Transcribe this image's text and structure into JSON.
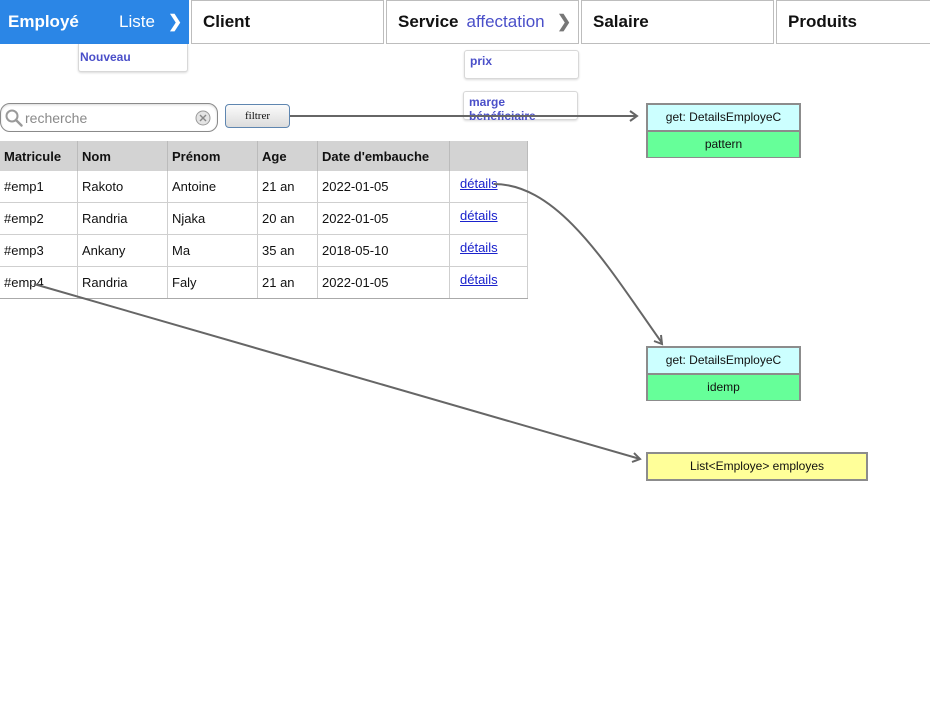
{
  "nav": {
    "tabs": [
      {
        "label": "Employé",
        "sub": "Liste",
        "chevron": "❯"
      },
      {
        "label": "Client"
      },
      {
        "label": "Service",
        "sub": "affectation",
        "chevron": "❯"
      },
      {
        "label": "Salaire"
      },
      {
        "label": "Produits"
      }
    ],
    "employe_menu": [
      "Nouveau"
    ],
    "service_menu": [
      "prix",
      "marge bénéficiaire"
    ]
  },
  "search": {
    "placeholder": "recherche",
    "filter_label": "filtrer"
  },
  "table": {
    "headers": [
      "Matricule",
      "Nom",
      "Prénom",
      "Age",
      "Date d'embauche",
      ""
    ],
    "rows": [
      {
        "matricule": "#emp1",
        "nom": "Rakoto",
        "prenom": "Antoine",
        "age": "21 an",
        "date": "2022-01-05",
        "link": "détails"
      },
      {
        "matricule": "#emp2",
        "nom": "Randria",
        "prenom": "Njaka",
        "age": "20 an",
        "date": "2022-01-05",
        "link": "détails"
      },
      {
        "matricule": "#emp3",
        "nom": "Ankany",
        "prenom": "Ma",
        "age": "35 an",
        "date": "2018-05-10",
        "link": "détails"
      },
      {
        "matricule": "#emp4",
        "nom": "Randria",
        "prenom": "Faly",
        "age": "21 an",
        "date": "2022-01-05",
        "link": "détails"
      }
    ]
  },
  "annotations": [
    {
      "top": "get: DetailsEmployeC",
      "bottom": "pattern"
    },
    {
      "top": "get: DetailsEmployeC",
      "bottom": "idemp"
    },
    {
      "label": "List<Employe> employes"
    }
  ],
  "colors": {
    "active_tab": "#2b86e6",
    "menu_text": "#4a4fc9",
    "box_top": "#ccffff",
    "box_bottom": "#66ff99",
    "box_list": "#ffff99",
    "arrow": "#666666"
  }
}
